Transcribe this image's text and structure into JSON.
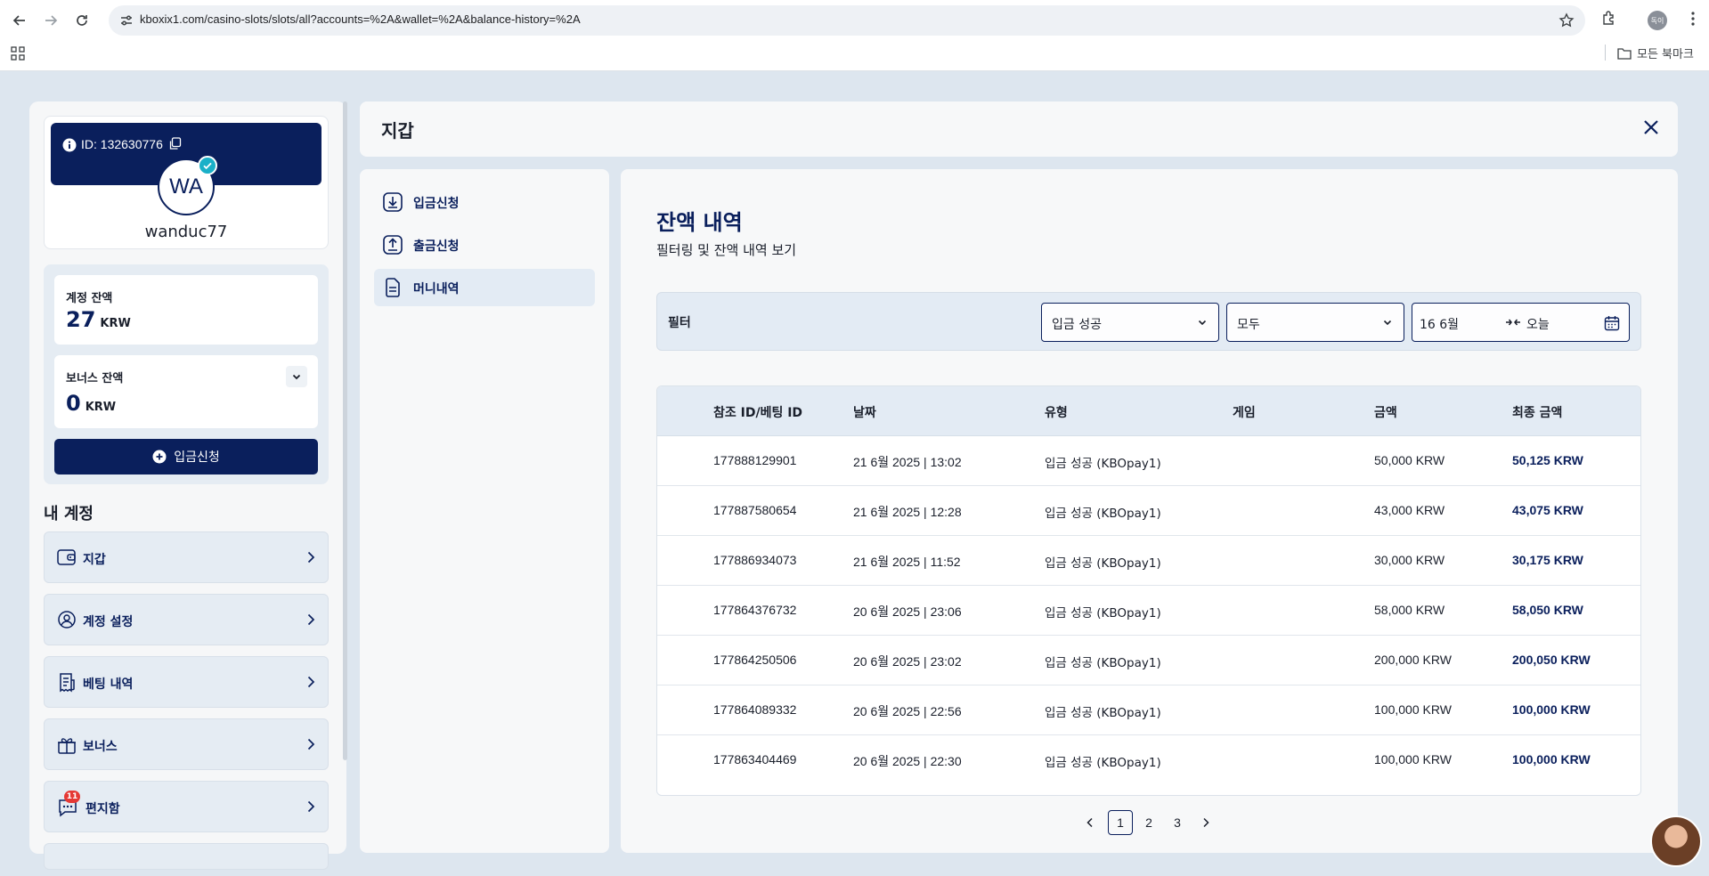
{
  "browser": {
    "url": "kboxix1.com/casino-slots/slots/all?accounts=%2A&wallet=%2A&balance-history=%2A",
    "profile_initial": "독이",
    "bookmarks_label": "모든 북마크"
  },
  "profile": {
    "id_text": "ID: 132630776",
    "avatar_initials": "WA",
    "username": "wanduc77"
  },
  "balances": {
    "account_label": "계정 잔액",
    "account_amount": "27",
    "account_currency": "KRW",
    "bonus_label": "보너스 잔액",
    "bonus_amount": "0",
    "bonus_currency": "KRW",
    "deposit_button": "입금신청"
  },
  "my_account": {
    "title": "내 계정",
    "items": [
      {
        "label": "지갑",
        "icon": "wallet-icon"
      },
      {
        "label": "계정 설정",
        "icon": "user-settings-icon"
      },
      {
        "label": "베팅 내역",
        "icon": "receipt-icon"
      },
      {
        "label": "보너스",
        "icon": "gift-icon"
      },
      {
        "label": "편지함",
        "icon": "message-icon",
        "badge": "11"
      }
    ]
  },
  "wallet": {
    "title": "지갑",
    "nav": [
      {
        "label": "입금신청",
        "icon": "download-icon"
      },
      {
        "label": "출금신청",
        "icon": "upload-icon"
      },
      {
        "label": "머니내역",
        "icon": "document-icon",
        "active": true
      }
    ]
  },
  "history": {
    "title": "잔액 내역",
    "subtitle": "필터링 및 잔액 내역 보기",
    "filter_label": "필터",
    "filter_type_value": "입금 성공",
    "filter_game_value": "모두",
    "date_from": "16 6월",
    "date_to": "오늘",
    "columns": [
      "참조 ID/베팅 ID",
      "날짜",
      "유형",
      "게임",
      "금액",
      "최종 금액"
    ],
    "rows": [
      {
        "ref": "177888129901",
        "date": "21 6월 2025 | 13:02",
        "type": "입금 성공 (KBOpay1)",
        "game": "",
        "amount": "50,000 KRW",
        "final": "50,125 KRW"
      },
      {
        "ref": "177887580654",
        "date": "21 6월 2025 | 12:28",
        "type": "입금 성공 (KBOpay1)",
        "game": "",
        "amount": "43,000 KRW",
        "final": "43,075 KRW"
      },
      {
        "ref": "177886934073",
        "date": "21 6월 2025 | 11:52",
        "type": "입금 성공 (KBOpay1)",
        "game": "",
        "amount": "30,000 KRW",
        "final": "30,175 KRW"
      },
      {
        "ref": "177864376732",
        "date": "20 6월 2025 | 23:06",
        "type": "입금 성공 (KBOpay1)",
        "game": "",
        "amount": "58,000 KRW",
        "final": "58,050 KRW"
      },
      {
        "ref": "177864250506",
        "date": "20 6월 2025 | 23:02",
        "type": "입금 성공 (KBOpay1)",
        "game": "",
        "amount": "200,000 KRW",
        "final": "200,050 KRW"
      },
      {
        "ref": "177864089332",
        "date": "20 6월 2025 | 22:56",
        "type": "입금 성공 (KBOpay1)",
        "game": "",
        "amount": "100,000 KRW",
        "final": "100,000 KRW"
      },
      {
        "ref": "177863404469",
        "date": "20 6월 2025 | 22:30",
        "type": "입금 성공 (KBOpay1)",
        "game": "",
        "amount": "100,000 KRW",
        "final": "100,000 KRW"
      }
    ],
    "pages": [
      "1",
      "2",
      "3"
    ],
    "current_page": "1"
  },
  "colors": {
    "navy": "#0a1f5c",
    "accent_teal": "#1ab0c8",
    "badge_red": "#e53935",
    "panel_bg": "#e5ecf3"
  }
}
